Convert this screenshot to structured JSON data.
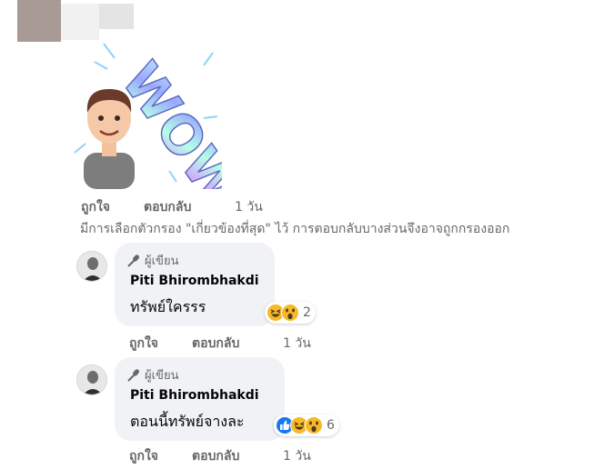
{
  "top_comment": {
    "sticker_word": "WOW",
    "actions": {
      "like": "ถูกใจ",
      "reply": "ตอบกลับ",
      "time": "1 วัน"
    }
  },
  "filter_notice": "มีการเลือกตัวกรอง \"เกี่ยวข้องที่สุด\" ไว้ การตอบกลับบางส่วนจึงอาจถูกกรองออก",
  "replies": [
    {
      "badge": "ผู้เขียน",
      "author": "Piti Bhirombhakdi",
      "text": "ทรัพย์ใครรร",
      "reactions": [
        "haha",
        "wow"
      ],
      "reaction_count": "2",
      "actions": {
        "like": "ถูกใจ",
        "reply": "ตอบกลับ",
        "time": "1 วัน"
      }
    },
    {
      "badge": "ผู้เขียน",
      "author": "Piti Bhirombhakdi",
      "text": "ตอนนี้ทรัพย์จางละ",
      "reactions": [
        "like",
        "haha",
        "wow"
      ],
      "reaction_count": "6",
      "actions": {
        "like": "ถูกใจ",
        "reply": "ตอบกลับ",
        "time": "1 วัน"
      }
    }
  ],
  "colors": {
    "bubble": "#f0f2f5",
    "secondary_text": "#65676b",
    "primary_text": "#050505",
    "like_blue": "#1877f2",
    "emoji_yellow": "#f7b928"
  }
}
